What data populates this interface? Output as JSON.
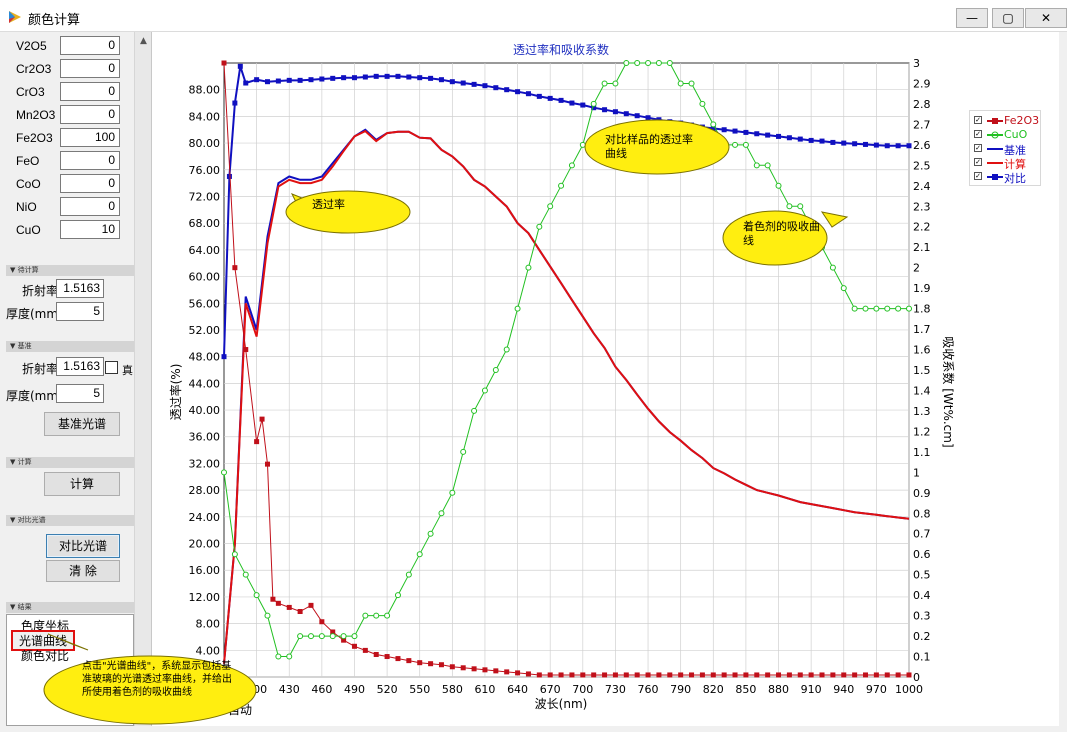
{
  "window": {
    "title": "颜色计算",
    "minimize": "—",
    "maximize": "▢",
    "close": "✕"
  },
  "oxides": [
    {
      "name": "V2O5",
      "value": "0"
    },
    {
      "name": "Cr2O3",
      "value": "0"
    },
    {
      "name": "CrO3",
      "value": "0"
    },
    {
      "name": "Mn2O3",
      "value": "0"
    },
    {
      "name": "Fe2O3",
      "value": "100"
    },
    {
      "name": "FeO",
      "value": "0"
    },
    {
      "name": "CoO",
      "value": "0"
    },
    {
      "name": "NiO",
      "value": "0"
    },
    {
      "name": "CuO",
      "value": "10"
    }
  ],
  "sections": {
    "to_calc": "待计算",
    "baseline": "基准",
    "calc": "计算",
    "compare": "对比光谱",
    "result": "结果"
  },
  "to_calc": {
    "refr_label": "折射率",
    "refr_value": "1.5163",
    "thick_label": "厚度(mm)",
    "thick_value": "5"
  },
  "baseline": {
    "refr_label": "折射率",
    "refr_value": "1.5163",
    "check_label": "真",
    "thick_label": "厚度(mm)",
    "thick_value": "5",
    "btn": "基准光谱"
  },
  "calc": {
    "btn": "计算"
  },
  "compare": {
    "btn_compare": "对比光谱",
    "btn_clear": "清  除"
  },
  "results": {
    "items": [
      "色度坐标",
      "光谱曲线",
      "颜色对比"
    ],
    "selected": "光谱曲线"
  },
  "bottom_partial": "自动",
  "callouts": {
    "transmittance": "透过率",
    "compare": "对比样品的透过率曲线",
    "absorption": "着色剂的吸收曲线",
    "hint": "点击\"光谱曲线\"，系统显示包括基准玻璃的光谱透过率曲线，并给出所使用着色剂的吸收曲线"
  },
  "legend": [
    {
      "check": "✓",
      "label": "Fe2O3",
      "color": "#c0101a"
    },
    {
      "check": "✓",
      "label": "CuO",
      "color": "#22c022"
    },
    {
      "check": "✓",
      "label": "基准",
      "color": "#1010c0"
    },
    {
      "check": "✓",
      "label": "计算",
      "color": "#e01010"
    },
    {
      "check": "✓",
      "label": "对比",
      "color": "#1010c0"
    }
  ],
  "chart_data": {
    "type": "line",
    "title": "透过率和吸收系数",
    "xlabel": "波长(nm)",
    "ylabel": "透过率(%)",
    "y2label": "吸收系数 [Wt%.cm]",
    "xlim": [
      370,
      1000
    ],
    "ylim": [
      0,
      92
    ],
    "y2lim": [
      0,
      3
    ],
    "x_ticks": [
      "400",
      "430",
      "460",
      "490",
      "520",
      "550",
      "580",
      "610",
      "640",
      "670",
      "700",
      "730",
      "760",
      "790",
      "820",
      "850",
      "880",
      "910",
      "940",
      "970",
      "1000"
    ],
    "y_ticks": [
      "0",
      "4.00",
      "8.00",
      "12.00",
      "16.00",
      "20.00",
      "24.00",
      "28.00",
      "32.00",
      "36.00",
      "40.00",
      "44.00",
      "48.00",
      "52.00",
      "56.00",
      "60.00",
      "64.00",
      "68.00",
      "72.00",
      "76.00",
      "80.00",
      "84.00",
      "88.00"
    ],
    "y2_ticks": [
      "0",
      "0.1",
      "0.2",
      "0.3",
      "0.4",
      "0.5",
      "0.6",
      "0.7",
      "0.8",
      "0.9",
      "1",
      "1.1",
      "1.2",
      "1.3",
      "1.4",
      "1.5",
      "1.6",
      "1.7",
      "1.8",
      "1.9",
      "2",
      "2.1",
      "2.2",
      "2.3",
      "2.4",
      "2.5",
      "2.6",
      "2.7",
      "2.8",
      "2.9",
      "3"
    ],
    "grid": true,
    "series": [
      {
        "name": "基准",
        "axis": "y",
        "color": "#1010c0",
        "marker": "none",
        "x": [
          370,
          380,
          390,
          400,
          410,
          420,
          430,
          440,
          450,
          460,
          470,
          480,
          490,
          500,
          510,
          520,
          530,
          540,
          550,
          560,
          570,
          580,
          590,
          600,
          610,
          620,
          630,
          640,
          650,
          660,
          670,
          680,
          690,
          700,
          710,
          720,
          730,
          740,
          750,
          760,
          770,
          780,
          790,
          800,
          810,
          820,
          830,
          840,
          850,
          860,
          870,
          880,
          890,
          900,
          910,
          920,
          930,
          940,
          950,
          960,
          970,
          980,
          990,
          1000
        ],
        "y": [
          2,
          20,
          57,
          52,
          66,
          74,
          75,
          74.5,
          74.5,
          75,
          77,
          79,
          81,
          82,
          80.5,
          81.5,
          81.7,
          81.7,
          80.8,
          80.7,
          79,
          78,
          76.5,
          74.5,
          73.5,
          72,
          70.5,
          68,
          66.5,
          64,
          61.5,
          59,
          56.5,
          54,
          51.5,
          49.3,
          46.5,
          44.5,
          42.3,
          40.2,
          38.3,
          36.7,
          35.4,
          34,
          32.8,
          31.3,
          30.5,
          29.6,
          28.8,
          28,
          27.6,
          27.2,
          26.7,
          26.2,
          25.9,
          25.6,
          25.3,
          25,
          24.7,
          24.5,
          24.3,
          24.1,
          23.9,
          23.7
        ]
      },
      {
        "name": "计算",
        "axis": "y",
        "color": "#e01010",
        "marker": "none",
        "x": [
          370,
          380,
          390,
          400,
          410,
          420,
          430,
          440,
          450,
          460,
          470,
          480,
          490,
          500,
          510,
          520,
          530,
          540,
          550,
          560,
          570,
          580,
          590,
          600,
          610,
          620,
          630,
          640,
          650,
          660,
          670,
          680,
          690,
          700,
          710,
          720,
          730,
          740,
          750,
          760,
          770,
          780,
          790,
          800,
          810,
          820,
          830,
          840,
          850,
          860,
          870,
          880,
          890,
          900,
          910,
          920,
          930,
          940,
          950,
          960,
          970,
          980,
          990,
          1000
        ],
        "y": [
          2,
          20,
          56,
          51,
          65,
          73.5,
          74.5,
          74,
          74,
          74.5,
          76.5,
          78.8,
          81,
          81.8,
          80.3,
          81.5,
          81.7,
          81.7,
          80.8,
          80.7,
          79,
          78,
          76.5,
          74.5,
          73.5,
          72,
          70.5,
          68,
          66.5,
          64,
          61.5,
          59,
          56.5,
          54,
          51.5,
          49.3,
          46.5,
          44.5,
          42.3,
          40.2,
          38.3,
          36.7,
          35.4,
          34,
          32.8,
          31.3,
          30.5,
          29.6,
          28.8,
          28,
          27.6,
          27.2,
          26.7,
          26.2,
          25.9,
          25.6,
          25.3,
          25,
          24.7,
          24.5,
          24.3,
          24.1,
          23.9,
          23.7
        ]
      },
      {
        "name": "对比",
        "axis": "y",
        "color": "#1010c0",
        "marker": "square",
        "x": [
          370,
          375,
          380,
          385,
          390,
          400,
          410,
          420,
          430,
          440,
          450,
          460,
          470,
          480,
          490,
          500,
          510,
          520,
          530,
          540,
          550,
          560,
          570,
          580,
          590,
          600,
          610,
          620,
          630,
          640,
          650,
          660,
          670,
          680,
          690,
          700,
          710,
          720,
          730,
          740,
          750,
          760,
          770,
          780,
          790,
          800,
          810,
          820,
          830,
          840,
          850,
          860,
          870,
          880,
          890,
          900,
          910,
          920,
          930,
          940,
          950,
          960,
          970,
          980,
          990,
          1000
        ],
        "y": [
          48,
          75,
          86,
          91.5,
          89,
          89.5,
          89.2,
          89.3,
          89.4,
          89.4,
          89.5,
          89.6,
          89.7,
          89.8,
          89.8,
          89.9,
          90,
          90,
          90,
          89.9,
          89.8,
          89.7,
          89.5,
          89.2,
          89,
          88.8,
          88.6,
          88.3,
          88,
          87.7,
          87.4,
          87,
          86.7,
          86.4,
          86,
          85.7,
          85.3,
          85,
          84.7,
          84.4,
          84.1,
          83.8,
          83.5,
          83.2,
          83,
          82.7,
          82.4,
          82.2,
          82,
          81.8,
          81.6,
          81.4,
          81.2,
          81,
          80.8,
          80.6,
          80.4,
          80.3,
          80.1,
          80,
          79.9,
          79.8,
          79.7,
          79.6,
          79.6,
          79.6
        ]
      },
      {
        "name": "Fe2O3",
        "axis": "y2",
        "color": "#c0101a",
        "marker": "square",
        "x": [
          370,
          380,
          390,
          400,
          405,
          410,
          415,
          420,
          430,
          440,
          450,
          460,
          470,
          480,
          490,
          500,
          510,
          520,
          530,
          540,
          550,
          560,
          570,
          580,
          590,
          600,
          610,
          620,
          630,
          640,
          650,
          660,
          670,
          680,
          690,
          700,
          710,
          720,
          730,
          740,
          750,
          760,
          770,
          780,
          790,
          800,
          810,
          820,
          830,
          840,
          850,
          860,
          870,
          880,
          890,
          900,
          910,
          920,
          930,
          940,
          950,
          960,
          970,
          980,
          990,
          1000
        ],
        "y": [
          3,
          2,
          1.6,
          1.15,
          1.26,
          1.04,
          0.38,
          0.36,
          0.34,
          0.32,
          0.35,
          0.27,
          0.22,
          0.18,
          0.15,
          0.13,
          0.11,
          0.1,
          0.09,
          0.08,
          0.07,
          0.065,
          0.06,
          0.05,
          0.045,
          0.04,
          0.035,
          0.03,
          0.025,
          0.02,
          0.015,
          0.01,
          0.01,
          0.01,
          0.01,
          0.01,
          0.01,
          0.01,
          0.01,
          0.01,
          0.01,
          0.01,
          0.01,
          0.01,
          0.01,
          0.01,
          0.01,
          0.01,
          0.01,
          0.01,
          0.01,
          0.01,
          0.01,
          0.01,
          0.01,
          0.01,
          0.01,
          0.01,
          0.01,
          0.01,
          0.01,
          0.01,
          0.01,
          0.01,
          0.01,
          0.01
        ]
      },
      {
        "name": "CuO",
        "axis": "y2",
        "color": "#22c022",
        "marker": "circle",
        "x": [
          370,
          380,
          390,
          400,
          410,
          420,
          430,
          440,
          450,
          460,
          470,
          480,
          490,
          500,
          510,
          520,
          530,
          540,
          550,
          560,
          570,
          580,
          590,
          600,
          610,
          620,
          630,
          640,
          650,
          660,
          670,
          680,
          690,
          700,
          710,
          720,
          730,
          740,
          750,
          760,
          770,
          780,
          790,
          800,
          810,
          820,
          830,
          840,
          850,
          860,
          870,
          880,
          890,
          900,
          910,
          920,
          930,
          940,
          950,
          960,
          970,
          980,
          990,
          1000
        ],
        "y": [
          1,
          0.6,
          0.5,
          0.4,
          0.3,
          0.1,
          0.1,
          0.2,
          0.2,
          0.2,
          0.2,
          0.2,
          0.2,
          0.3,
          0.3,
          0.3,
          0.4,
          0.5,
          0.6,
          0.7,
          0.8,
          0.9,
          1.1,
          1.3,
          1.4,
          1.5,
          1.6,
          1.8,
          2,
          2.2,
          2.3,
          2.4,
          2.5,
          2.6,
          2.8,
          2.9,
          2.9,
          3,
          3,
          3,
          3,
          3,
          2.9,
          2.9,
          2.8,
          2.7,
          2.6,
          2.6,
          2.6,
          2.5,
          2.5,
          2.4,
          2.3,
          2.3,
          2.2,
          2.1,
          2,
          1.9,
          1.8,
          1.8,
          1.8,
          1.8,
          1.8,
          1.8
        ]
      }
    ]
  }
}
